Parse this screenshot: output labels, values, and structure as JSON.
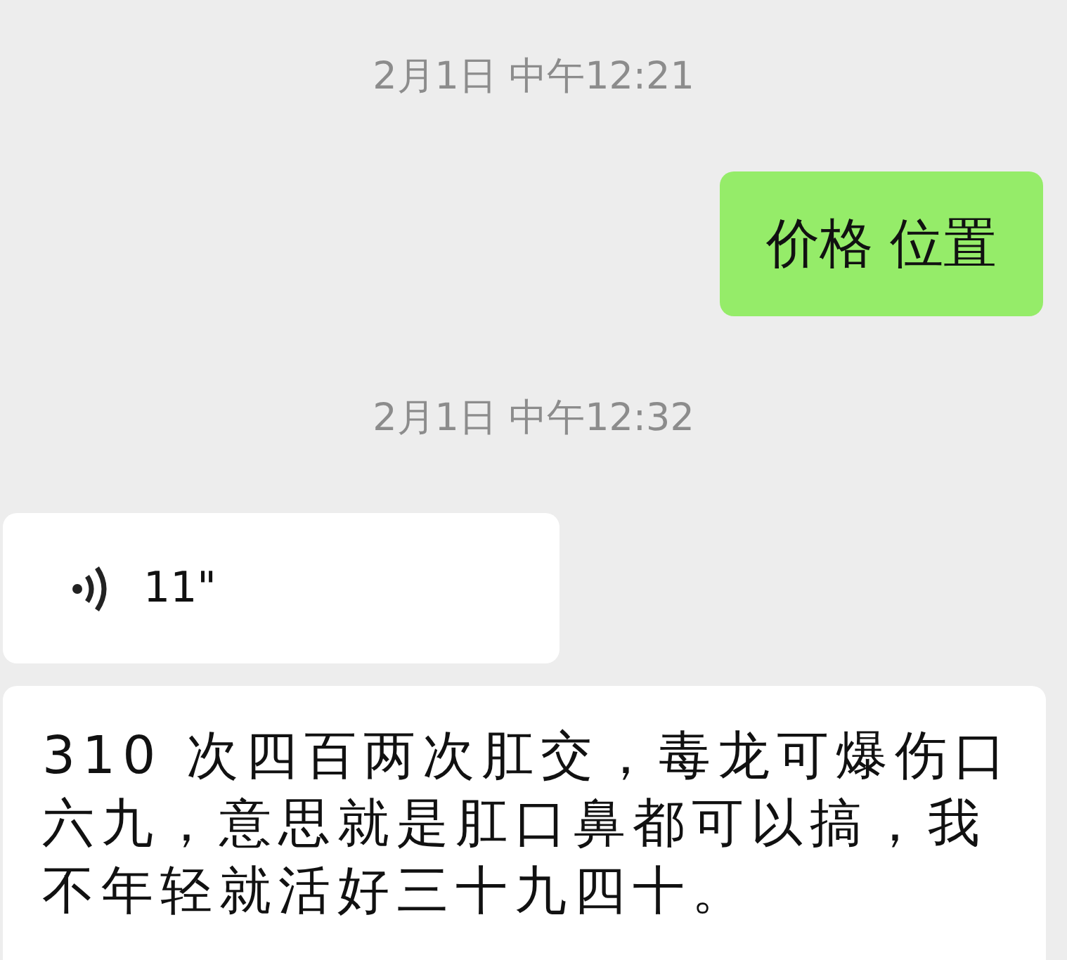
{
  "messages": [
    {
      "kind": "time",
      "text": "2月1日 中午12:21"
    },
    {
      "kind": "sent_text",
      "text": "价格 位置"
    },
    {
      "kind": "time",
      "text": "2月1日 中午12:32"
    },
    {
      "kind": "received_voice",
      "duration": "11\""
    },
    {
      "kind": "received_text",
      "text": "310 次四百两次肛交，毒龙可爆伤口六九，意思就是肛口鼻都可以搞，我不年轻就活好三十九四十。"
    }
  ]
}
